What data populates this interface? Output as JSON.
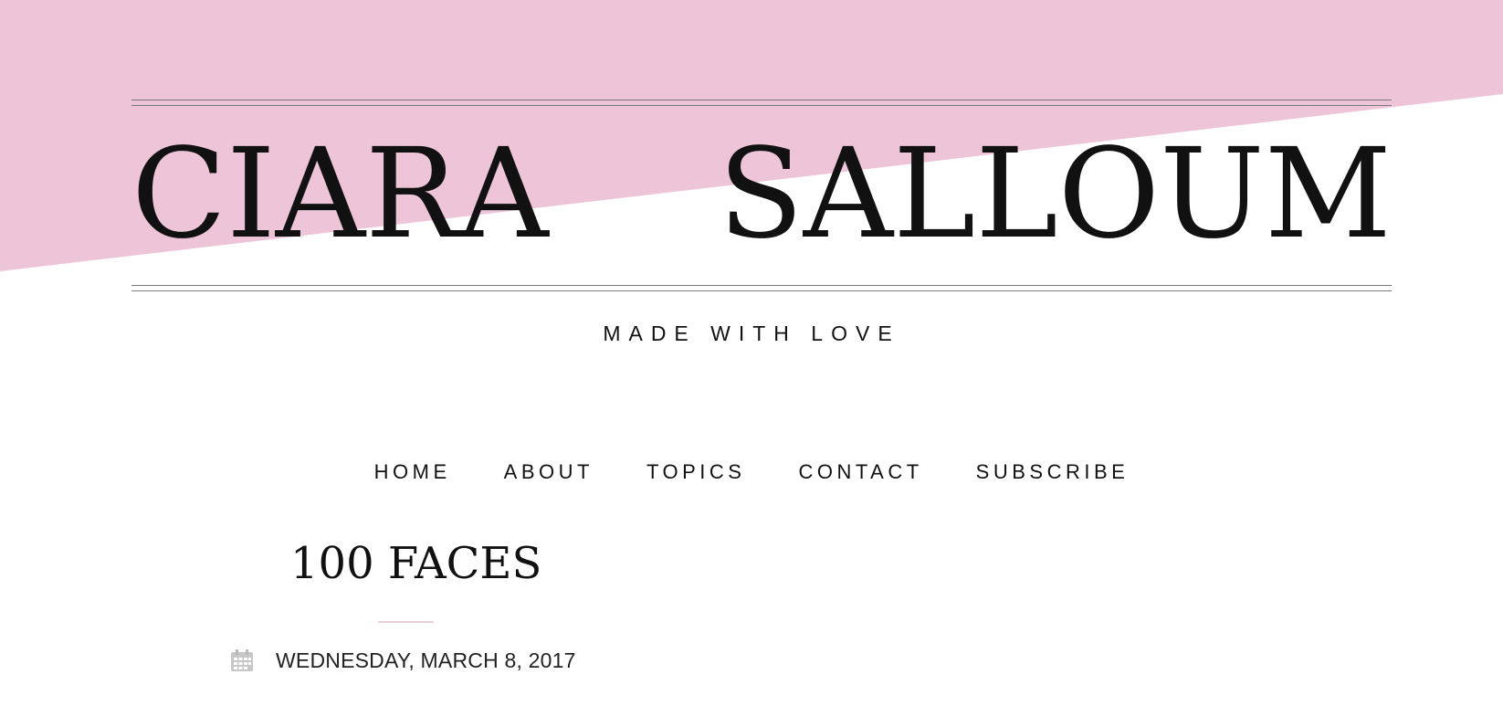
{
  "site": {
    "title": "CIARA SALLOUM",
    "tagline": "MADE WITH LOVE"
  },
  "nav": {
    "items": [
      {
        "label": "HOME"
      },
      {
        "label": "ABOUT"
      },
      {
        "label": "TOPICS"
      },
      {
        "label": "CONTACT"
      },
      {
        "label": "SUBSCRIBE"
      }
    ]
  },
  "post": {
    "title": "100 FACES",
    "date": "WEDNESDAY, MARCH 8, 2017",
    "date_icon": "calendar-icon"
  },
  "colors": {
    "accent_pink": "#eec4d8",
    "underline_pink": "#ead0db",
    "text": "#111111",
    "rule_gray": "#7a7a7a"
  }
}
